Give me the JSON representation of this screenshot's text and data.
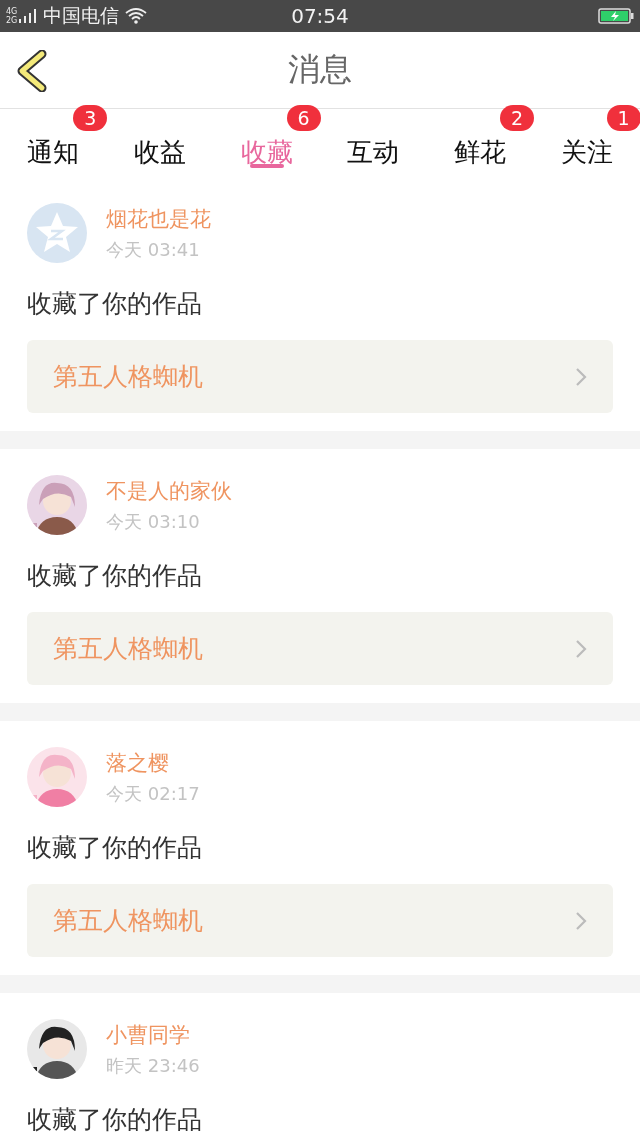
{
  "status_bar": {
    "network_top": "4G",
    "network_bottom": "2G",
    "carrier": "中国电信",
    "time": "07:54"
  },
  "header": {
    "title": "消息"
  },
  "tabs": [
    {
      "label": "通知",
      "badge": "3",
      "selected": false
    },
    {
      "label": "收益",
      "selected": false
    },
    {
      "label": "收藏",
      "badge": "6",
      "selected": true
    },
    {
      "label": "互动",
      "selected": false
    },
    {
      "label": "鲜花",
      "badge": "2",
      "selected": false
    },
    {
      "label": "关注",
      "badge": "1",
      "selected": false
    }
  ],
  "messages": [
    {
      "kind": "default",
      "name": "烟花也是花",
      "time": "今天 03:41",
      "action": "收藏了你的作品",
      "work": "第五人格蜘机"
    },
    {
      "kind": "picture",
      "name": "不是人的家伙",
      "time": "今天 03:10",
      "action": "收藏了你的作品",
      "work": "第五人格蜘机"
    },
    {
      "kind": "picture",
      "name": "落之樱",
      "time": "今天 02:17",
      "action": "收藏了你的作品",
      "work": "第五人格蜘机"
    },
    {
      "kind": "picture",
      "name": "小曹同学",
      "time": "昨天 23:46",
      "action": "收藏了你的作品"
    }
  ]
}
